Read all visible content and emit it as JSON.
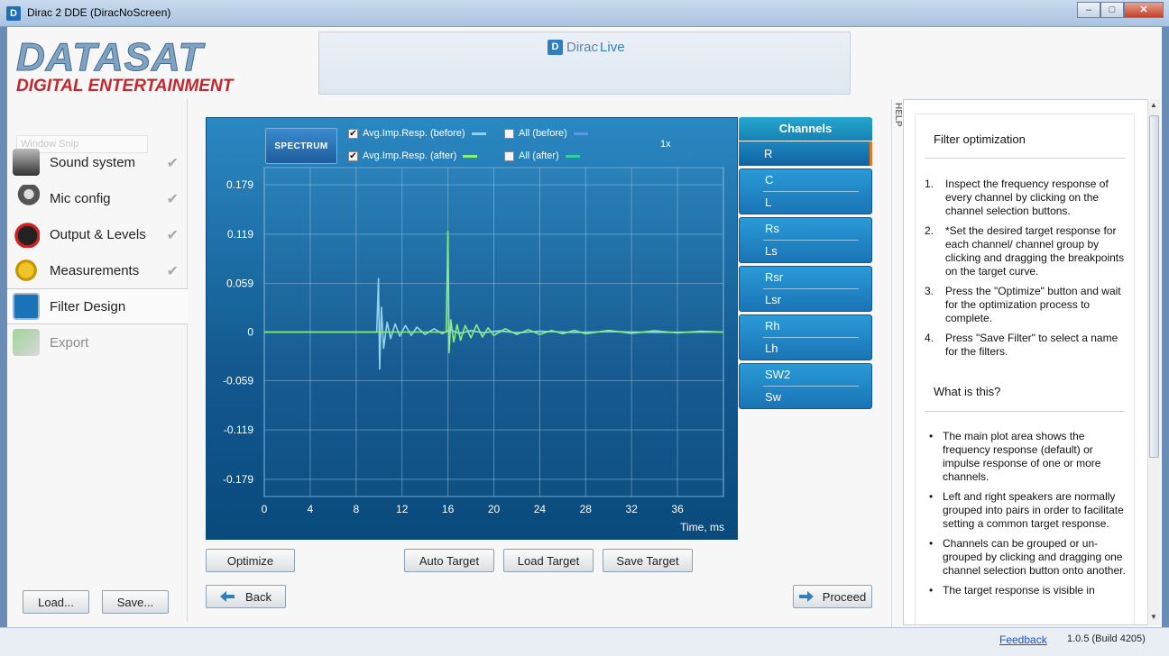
{
  "window": {
    "title": "Dirac 2 DDE (DiracNoScreen)",
    "minimize": "‒",
    "maximize": "□",
    "close": "✕"
  },
  "logo": {
    "line1": "DATASAT",
    "line2": "DIGITAL ENTERTAINMENT"
  },
  "header": {
    "brand_dirac": "Dirac",
    "brand_live": "Live",
    "brand_mark": "D"
  },
  "sidebar": {
    "snip_label": "Window Snip",
    "check": "✔",
    "items": [
      {
        "label": "Sound system",
        "done": true
      },
      {
        "label": "Mic config",
        "done": true
      },
      {
        "label": "Output & Levels",
        "done": true
      },
      {
        "label": "Measurements",
        "done": true
      },
      {
        "label": "Filter Design",
        "done": false
      },
      {
        "label": "Export",
        "done": false
      }
    ],
    "load_label": "Load...",
    "save_label": "Save..."
  },
  "plot": {
    "spectrum_label": "SPECTRUM",
    "zoom": "1x",
    "legend": [
      {
        "label": "Avg.Imp.Resp. (before)",
        "checked": true,
        "color": "#8fd3ee"
      },
      {
        "label": "All (before)",
        "checked": false,
        "color": "#6c8ff0"
      },
      {
        "label": "Avg.Imp.Resp. (after)",
        "checked": true,
        "color": "#86f07a"
      },
      {
        "label": "All (after)",
        "checked": false,
        "color": "#2bd19a"
      }
    ],
    "checkmark": "✔"
  },
  "chart_data": {
    "type": "line",
    "xlabel": "Time, ms",
    "ylabel": "",
    "xlim": [
      0,
      40
    ],
    "ylim": [
      -0.2,
      0.2
    ],
    "x_ticks": [
      0,
      4,
      8,
      12,
      16,
      20,
      24,
      28,
      32,
      36
    ],
    "y_ticks": [
      0.179,
      0.119,
      0.059,
      0,
      -0.059,
      -0.119,
      -0.179
    ],
    "y_tick_labels": [
      "0.179",
      "0.119",
      "0.059",
      "0",
      "-0.059",
      "-0.119",
      "-0.179"
    ],
    "series": [
      {
        "color": "#8fd3ee",
        "x": [
          0,
          9.8,
          9.95,
          10.05,
          10.2,
          10.4,
          10.7,
          11.0,
          11.4,
          11.8,
          12.3,
          12.8,
          13.3,
          14.0,
          14.8,
          15.5,
          16.2,
          17.0,
          18.0,
          19.0,
          20.5,
          22.0,
          24.0,
          27.0,
          30.0,
          34.0,
          40.0
        ],
        "y": [
          0,
          0,
          0.065,
          -0.045,
          0.03,
          -0.02,
          0.012,
          -0.008,
          0.01,
          -0.005,
          0.008,
          -0.004,
          0.006,
          -0.003,
          0.004,
          -0.002,
          0.003,
          -0.002,
          0.002,
          -0.001,
          0.0015,
          -0.001,
          0.001,
          -0.0005,
          0.0005,
          -0.0003,
          0
        ]
      },
      {
        "color": "#86f07a",
        "x": [
          0,
          15.85,
          16.0,
          16.1,
          16.25,
          16.5,
          16.8,
          17.1,
          17.5,
          18.0,
          18.5,
          19.0,
          19.5,
          20.0,
          21.0,
          22.0,
          23.0,
          24.0,
          25.0,
          26.0,
          27.0,
          28.0,
          30.0,
          32.0,
          34.0,
          36.0,
          38.0,
          40.0
        ],
        "y": [
          0,
          0,
          0.122,
          -0.025,
          0.015,
          -0.012,
          0.009,
          -0.01,
          0.008,
          -0.007,
          0.009,
          -0.006,
          0.005,
          -0.004,
          0.004,
          -0.003,
          0.003,
          -0.003,
          0.002,
          -0.002,
          0.002,
          -0.002,
          0.002,
          -0.0015,
          0.0015,
          -0.001,
          0.001,
          0
        ]
      }
    ]
  },
  "channels": {
    "title": "Channels",
    "selected": "R",
    "groups": [
      [
        "C",
        "L"
      ],
      [
        "Rs",
        "Ls"
      ],
      [
        "Rsr",
        "Lsr"
      ],
      [
        "Rh",
        "Lh"
      ],
      [
        "SW2",
        "Sw"
      ]
    ]
  },
  "buttons": {
    "optimize": "Optimize",
    "auto_target": "Auto Target",
    "load_target": "Load Target",
    "save_target": "Save Target",
    "back": "Back",
    "proceed": "Proceed"
  },
  "help": {
    "tab_label": "HELP",
    "title": "Filter optimization",
    "steps": [
      "Inspect the frequency response of every channel by clicking on the channel selection buttons.",
      "*Set the desired target response for each channel/ channel group by clicking and dragging the breakpoints on the target curve.",
      "Press the \"Optimize\" button and wait for the optimization process to complete.",
      "Press \"Save Filter\" to select a name for the filters."
    ],
    "subtitle": "What is this?",
    "bullets": [
      "The main plot area shows the frequency response (default) or impulse response of one or more channels.",
      "Left and right speakers are normally grouped into pairs in order to facilitate setting a common target response.",
      "Channels can be grouped or un-grouped by clicking and dragging one channel selection button onto another.",
      "The target response is visible in"
    ]
  },
  "status": {
    "feedback": "Feedback",
    "version": "1.0.5 (Build 4205)"
  }
}
